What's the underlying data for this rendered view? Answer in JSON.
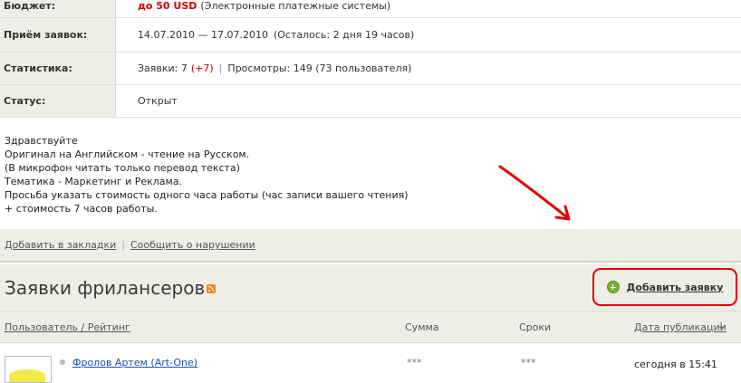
{
  "info": {
    "budget": {
      "label": "Бюджет:",
      "amount": "до 50 USD",
      "note": "(Электронные платежные системы)"
    },
    "applications": {
      "label": "Приём заявок:",
      "value": "14.07.2010 — 17.07.2010",
      "remaining": "(Осталось: 2 дня 19 часов)"
    },
    "statistics": {
      "label": "Статистика:",
      "apps_text": "Заявки: 7",
      "apps_new": "(+7)",
      "views": "Просмотры: 149 (73 пользователя)"
    },
    "status": {
      "label": "Статус:",
      "value": "Открыт"
    }
  },
  "description": [
    "Здравствуйте",
    "Оригинал на Английском - чтение на Русском.",
    "(В микрофон читать только перевод текста)",
    "Тематика - Маркетинг и Реклама.",
    "Просьба указать стоимость одного часа работы (час записи вашего чтения)",
    "+ стоимость 7 часов работы."
  ],
  "actions": {
    "bookmark": "Добавить в закладки",
    "report": "Сообщить о нарушении"
  },
  "section": {
    "title": "Заявки фрилансеров",
    "add_button": "Добавить заявку"
  },
  "columns": {
    "user": "Пользователь / Рейтинг",
    "sum": "Сумма",
    "term": "Сроки",
    "date": "Дата публикации",
    "sort_arrow": "↓"
  },
  "rows": [
    {
      "user": "Фролов Артем (Art-One)",
      "sum": "***",
      "term": "***",
      "date": "сегодня в 15:41"
    }
  ],
  "colors": {
    "accent_red": "#d40000",
    "annotation_red": "#e30000",
    "panel_bg": "#eeeee6",
    "link_blue": "#1a4fb5"
  }
}
